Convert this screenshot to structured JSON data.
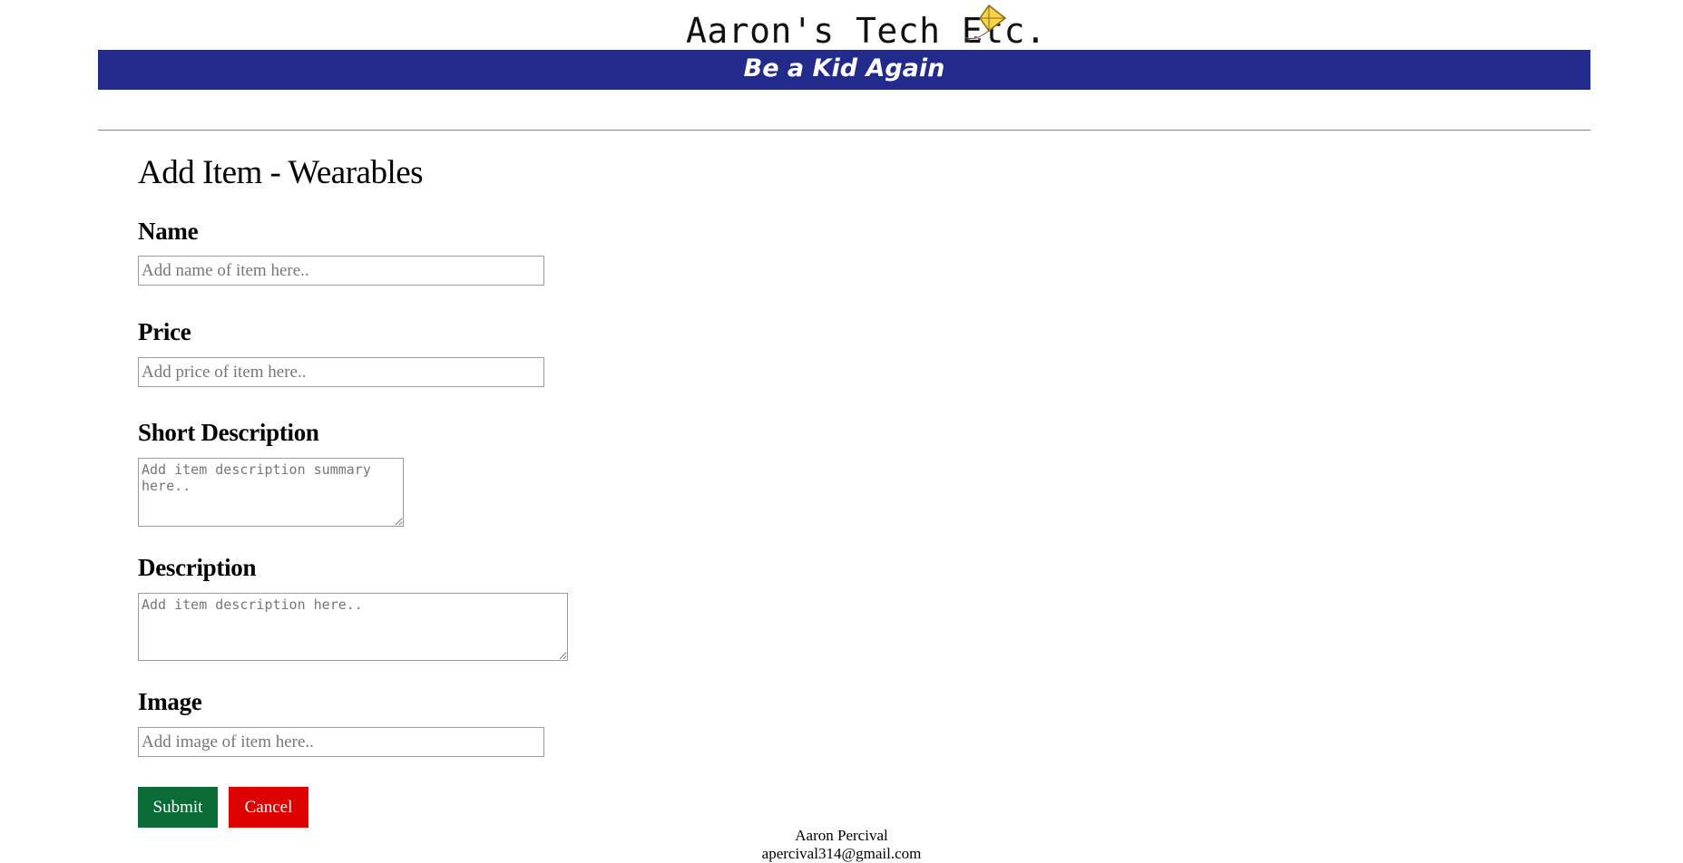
{
  "header": {
    "logo_text": "Aaron's Tech Etc.",
    "tagline": "Be a Kid Again",
    "banner_color": "#222b8c",
    "logo_icon": "kite-icon"
  },
  "form": {
    "title": "Add Item - Wearables",
    "fields": {
      "name": {
        "label": "Name",
        "value": "",
        "placeholder": "Add name of item here.."
      },
      "price": {
        "label": "Price",
        "value": "",
        "placeholder": "Add price of item here.."
      },
      "short_description": {
        "label": "Short Description",
        "value": "",
        "placeholder": "Add item description summary here.."
      },
      "description": {
        "label": "Description",
        "value": "",
        "placeholder": "Add item description here.."
      },
      "image": {
        "label": "Image",
        "value": "",
        "placeholder": "Add image of item here.."
      }
    },
    "submit_label": "Submit",
    "cancel_label": "Cancel",
    "submit_color": "#0b6b37",
    "cancel_color": "#dd0000"
  },
  "footer": {
    "name": "Aaron Percival",
    "email": "apercival314@gmail.com"
  }
}
